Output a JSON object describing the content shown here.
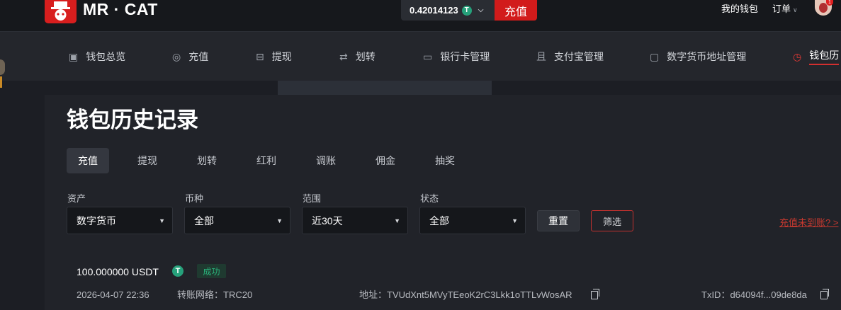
{
  "header": {
    "brand": "MR · CAT",
    "balance": "0.42014123",
    "currency_icon": "T",
    "deposit_button": "充值",
    "my_wallet": "我的钱包",
    "orders": "订单",
    "notification_count": "1",
    "colors": {
      "accent": "#d21b1b",
      "usdt": "#26a17b"
    }
  },
  "nav": {
    "items": [
      {
        "label": "钱包总览",
        "icon": "wallet-icon"
      },
      {
        "label": "充值",
        "icon": "deposit-icon"
      },
      {
        "label": "提现",
        "icon": "withdraw-icon"
      },
      {
        "label": "划转",
        "icon": "transfer-icon"
      },
      {
        "label": "银行卡管理",
        "icon": "bank-card-icon"
      },
      {
        "label": "支付宝管理",
        "icon": "alipay-icon"
      },
      {
        "label": "数字货币地址管理",
        "icon": "crypto-address-icon"
      },
      {
        "label": "钱包历",
        "icon": "history-icon",
        "active": true
      }
    ]
  },
  "page": {
    "title": "钱包历史记录",
    "tabs": [
      "充值",
      "提现",
      "划转",
      "红利",
      "调账",
      "佣金",
      "抽奖"
    ],
    "active_tab": "充值"
  },
  "filters": {
    "asset": {
      "label": "资产",
      "value": "数字货币"
    },
    "currency": {
      "label": "币种",
      "value": "全部"
    },
    "range": {
      "label": "范围",
      "value": "近30天"
    },
    "status": {
      "label": "状态",
      "value": "全部"
    },
    "reset_button": "重置",
    "filter_button": "筛选",
    "help_link": "充值未到账? >"
  },
  "records": [
    {
      "amount": "100.000000 USDT",
      "status": "成功",
      "time": "2026-04-07 22:36",
      "network": "转账网络：TRC20",
      "address": "地址：TVUdXnt5MVyTEeoK2rC3Lkk1oTTLvWosAR",
      "txid": "TxID：d64094f...09de8da"
    }
  ]
}
